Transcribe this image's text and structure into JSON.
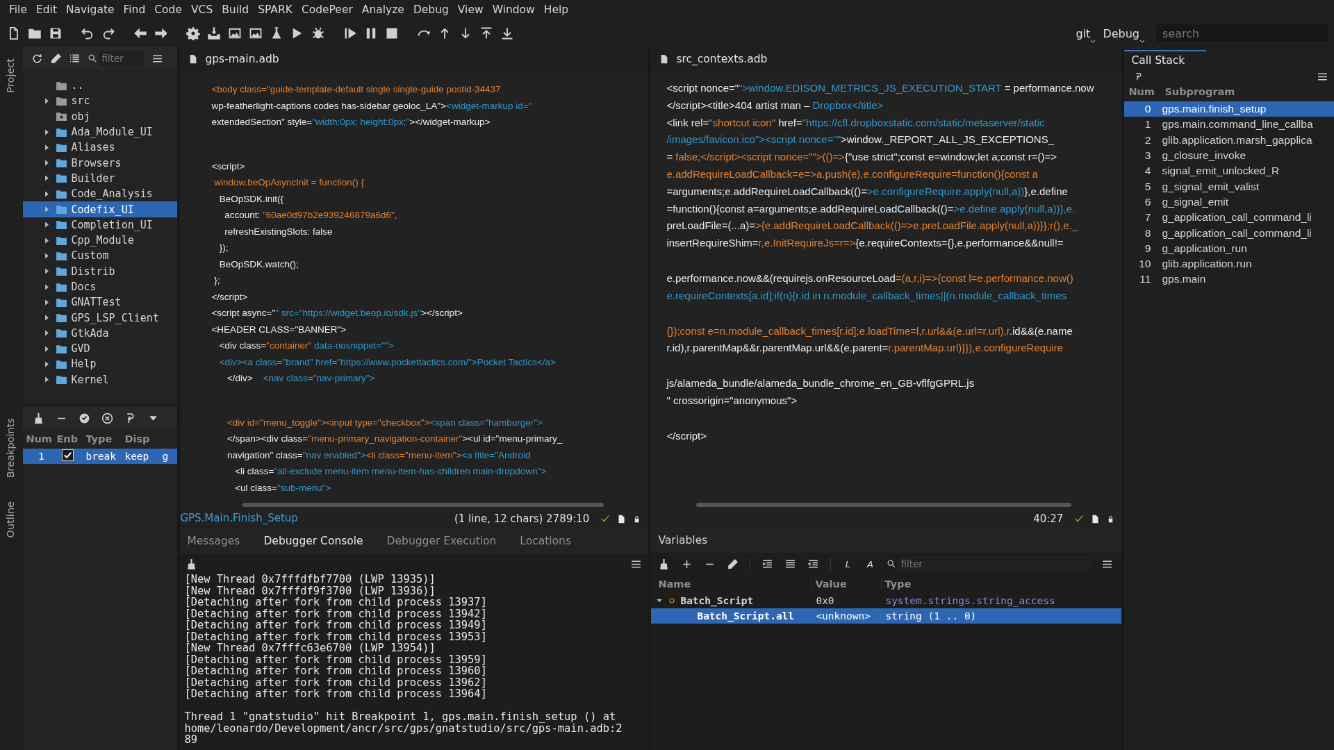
{
  "menu": [
    "File",
    "Edit",
    "Navigate",
    "Find",
    "Code",
    "VCS",
    "Build",
    "SPARK",
    "CodePeer",
    "Analyze",
    "Debug",
    "View",
    "Window",
    "Help"
  ],
  "toolbar_right": {
    "vcs": "git",
    "build_mode": "Debug",
    "search": {
      "placeholder": "search"
    }
  },
  "side_tabs": {
    "top": "Project",
    "bottom": [
      "Breakpoints",
      "Outline"
    ]
  },
  "project": {
    "filter": {
      "placeholder": "filter"
    },
    "items": [
      {
        "label": "..",
        "kind": "parent",
        "selected": false
      },
      {
        "label": "src",
        "kind": "source",
        "selected": false
      },
      {
        "label": "obj",
        "kind": "object",
        "selected": false
      },
      {
        "label": "Ada_Module_UI",
        "kind": "folder",
        "selected": false
      },
      {
        "label": "Aliases",
        "kind": "folder",
        "selected": false
      },
      {
        "label": "Browsers",
        "kind": "folder",
        "selected": false
      },
      {
        "label": "Builder",
        "kind": "folder",
        "selected": false
      },
      {
        "label": "Code_Analysis",
        "kind": "folder",
        "selected": false
      },
      {
        "label": "Codefix_UI",
        "kind": "folder",
        "selected": true
      },
      {
        "label": "Completion_UI",
        "kind": "folder",
        "selected": false
      },
      {
        "label": "Cpp_Module",
        "kind": "folder",
        "selected": false
      },
      {
        "label": "Custom",
        "kind": "folder",
        "selected": false
      },
      {
        "label": "Distrib",
        "kind": "folder",
        "selected": false
      },
      {
        "label": "Docs",
        "kind": "folder",
        "selected": false
      },
      {
        "label": "GNATTest",
        "kind": "folder",
        "selected": false
      },
      {
        "label": "GPS_LSP_Client",
        "kind": "folder",
        "selected": false
      },
      {
        "label": "GtkAda",
        "kind": "folder",
        "selected": false
      },
      {
        "label": "GVD",
        "kind": "folder",
        "selected": false
      },
      {
        "label": "Help",
        "kind": "folder",
        "selected": false
      },
      {
        "label": "Kernel",
        "kind": "folder",
        "selected": false
      }
    ]
  },
  "breakpoints": {
    "columns": [
      "Num",
      "Enb",
      "Type",
      "Disp"
    ],
    "rows": [
      {
        "num": "1",
        "enabled": true,
        "type": "break",
        "disp": "keep",
        "column_5": "g",
        "selected": true
      }
    ]
  },
  "editor_left": {
    "file": "gps-main.adb",
    "blocks": [
      [
        [
          {
            "kind": "keyword",
            "text": "<body class=\"guide-template-default single single-guide postid-34437"
          }
        ],
        [
          {
            "kind": "plain",
            "text": "wp-featherlight-captions codes has-sidebar geoloc_LA\">"
          },
          {
            "kind": "string",
            "text": "<widget-markup id=\""
          }
        ],
        [
          {
            "kind": "plain",
            "text": "extendedSection\" style="
          },
          {
            "kind": "string",
            "text": "\"width:0px; height:0px;\""
          },
          {
            "kind": "plain",
            "text": "></widget-markup>"
          }
        ]
      ],
      [
        [
          {
            "kind": "plain",
            "text": "<script>"
          }
        ],
        [
          {
            "kind": "keyword",
            "text": " window.beOpAsyncInit = function() {"
          }
        ],
        [
          {
            "kind": "plain",
            "text": "   BeOpSDK.init({"
          }
        ],
        [
          {
            "kind": "plain",
            "text": "     account: "
          },
          {
            "kind": "keyword",
            "text": "\"60ae0d97b2e939246879a6d6\","
          }
        ],
        [
          {
            "kind": "plain",
            "text": "     refreshExistingSlots: false"
          }
        ],
        [
          {
            "kind": "plain",
            "text": "   });"
          }
        ],
        [
          {
            "kind": "plain",
            "text": "   BeOpSDK.watch();"
          }
        ],
        [
          {
            "kind": "plain",
            "text": " };"
          }
        ],
        [
          {
            "kind": "plain",
            "text": "</script>"
          }
        ],
        [
          {
            "kind": "plain",
            "text": "<script async=\""
          },
          {
            "kind": "string",
            "text": "\" src=\"https://widget.beop.io/sdk.js\""
          },
          {
            "kind": "plain",
            "text": "></script>"
          }
        ],
        [
          {
            "kind": "plain",
            "text": "<HEADER CLASS=\"BANNER\">"
          }
        ],
        [
          {
            "kind": "plain",
            "text": "   <div class="
          },
          {
            "kind": "keyword",
            "text": "\"container\""
          },
          {
            "kind": "string",
            "text": " data-nosnippet=\"\">"
          }
        ],
        [
          {
            "kind": "string",
            "text": "   <div><a class=\"brand\" href=\"https://www.pockettactics.com/\">Pocket Tactics</a>"
          }
        ],
        [
          {
            "kind": "plain",
            "text": "      </div>    "
          },
          {
            "kind": "string",
            "text": "<nav class=\"nav-primary\">"
          }
        ]
      ],
      [
        [
          {
            "kind": "keyword",
            "text": "      <div id=\"menu_toggle\"><input type=\"checkbox\">"
          },
          {
            "kind": "string",
            "text": "<span class=\"hamburger\">"
          }
        ],
        [
          {
            "kind": "plain",
            "text": "      </span><div class="
          },
          {
            "kind": "keyword",
            "text": "\"menu-primary_navigation-container\""
          },
          {
            "kind": "plain",
            "text": "><ul id=\"menu-primary_"
          }
        ],
        [
          {
            "kind": "plain",
            "text": "      navigation\" class="
          },
          {
            "kind": "string",
            "text": "\"nav enabled\">"
          },
          {
            "kind": "keyword",
            "text": "<li class=\"menu-item\">"
          },
          {
            "kind": "string",
            "text": "<a title=\"Android"
          }
        ],
        [
          {
            "kind": "plain",
            "text": "         <li class="
          },
          {
            "kind": "string",
            "text": "\"all-exclude menu-item menu-item-has-children main-dropdown\">"
          }
        ],
        [
          {
            "kind": "plain",
            "text": "         <ul class="
          },
          {
            "kind": "string",
            "text": "\"sub-menu\">"
          }
        ]
      ]
    ],
    "status": {
      "scope": "GPS.Main.Finish_Setup",
      "position": "(1 line, 12 chars) 2789:10"
    }
  },
  "editor_right": {
    "file": "src_contexts.adb",
    "blocks": [
      [
        [
          {
            "kind": "plain",
            "text": "<script nonce=\""
          },
          {
            "kind": "string",
            "text": "\">window.EDISON_METRICS_JS_EXECUTION_START"
          },
          {
            "kind": "plain",
            "text": " = performance.now"
          }
        ],
        [
          {
            "kind": "plain",
            "text": "</script><title>404 artist man – "
          },
          {
            "kind": "string",
            "text": "Dropbox</title>"
          }
        ],
        [
          {
            "kind": "plain",
            "text": "<link rel="
          },
          {
            "kind": "keyword",
            "text": "\"shortcut icon\""
          },
          {
            "kind": "plain",
            "text": " href="
          },
          {
            "kind": "string",
            "text": "\"https://cfl.dropboxstatic.com/static/metaserver/static"
          }
        ],
        [
          {
            "kind": "string",
            "text": "/images/favicon.ico\"><script nonce=\"\""
          },
          {
            "kind": "plain",
            "text": ">window._REPORT_ALL_JS_EXCEPTIONS_"
          }
        ],
        [
          {
            "kind": "plain",
            "text": "= "
          },
          {
            "kind": "keyword",
            "text": "false;</script><script nonce=\"\">(()=>"
          },
          {
            "kind": "plain",
            "text": "{\"use strict\";const e=window;let a;const r=()=>"
          }
        ],
        [
          {
            "kind": "keyword",
            "text": "e.addRequireLoadCallback=e=>a.push(e),e.configureRequire=function(){const a"
          }
        ],
        [
          {
            "kind": "plain",
            "text": "=arguments;e.addRequireLoadCallback(()="
          },
          {
            "kind": "string",
            "text": ">e.configureRequire.apply(null,a))"
          },
          {
            "kind": "plain",
            "text": "},e.define"
          }
        ],
        [
          {
            "kind": "plain",
            "text": "=function(){const a=arguments;e.addRequireLoadCallback(()="
          },
          {
            "kind": "string",
            "text": ">e.define.apply(null,a))},e."
          }
        ],
        [
          {
            "kind": "plain",
            "text": "preLoadFile=(...a)="
          },
          {
            "kind": "keyword",
            "text": ">{e.addRequireLoadCallback(()=>e.preLoadFile.apply(null,a))}};r(),e._"
          }
        ],
        [
          {
            "kind": "plain",
            "text": "insertRequireShim="
          },
          {
            "kind": "keyword",
            "text": "r,e.InitRequireJs=r=>"
          },
          {
            "kind": "plain",
            "text": "{e.requireContexts={},e.performance&&null!="
          }
        ]
      ],
      [
        [
          {
            "kind": "plain",
            "text": "e.performance.now&&(requirejs.onResourceLoad"
          },
          {
            "kind": "keyword",
            "text": "=(a,r,i)=>{const l=e.performance.now()"
          }
        ],
        [
          {
            "kind": "string",
            "text": "e.requireContexts[a.id];if(n){r.id in n.module_callback_times||(n.module_callback_times"
          }
        ]
      ],
      [
        [
          {
            "kind": "keyword",
            "text": "{});const e=n.module_callback_times[r.id];e.loadTime=l,r.url&&(e.url=r.url),r"
          },
          {
            "kind": "plain",
            "text": ".id&&(e.name"
          }
        ],
        [
          {
            "kind": "plain",
            "text": "r.id),r.parentMap&&r.parentMap.url&&(e.parent="
          },
          {
            "kind": "keyword",
            "text": "r.parentMap.url)}}),e.configureRequire"
          }
        ]
      ],
      [
        [
          {
            "kind": "plain",
            "text": "js/alameda_bundle/alameda_bundle_chrome_en_GB-vflfgGPRL.js"
          }
        ],
        [
          {
            "kind": "plain",
            "text": "\" crossorigin=\"anonymous\">"
          }
        ]
      ],
      [
        [
          {
            "kind": "plain",
            "text": "</script>"
          }
        ]
      ]
    ],
    "status": {
      "position": "40:27"
    }
  },
  "console": {
    "tabs": [
      {
        "label": "Messages",
        "selected": false
      },
      {
        "label": "Debugger Console",
        "selected": true
      },
      {
        "label": "Debugger Execution",
        "selected": false
      },
      {
        "label": "Locations",
        "selected": false
      }
    ],
    "output": [
      "[New Thread 0x7fffdfbf7700 (LWP 13935)]",
      "[New Thread 0x7fffdf9f3700 (LWP 13936)]",
      "[Detaching after fork from child process 13937]",
      "[Detaching after fork from child process 13942]",
      "[Detaching after fork from child process 13949]",
      "[Detaching after fork from child process 13953]",
      "[New Thread 0x7fffc63e6700 (LWP 13954)]",
      "[Detaching after fork from child process 13959]",
      "[Detaching after fork from child process 13960]",
      "[Detaching after fork from child process 13962]",
      "[Detaching after fork from child process 13964]"
    ],
    "stop_message": [
      "Thread 1 \"gnatstudio\" hit Breakpoint 1, gps.main.finish_setup () at",
      "home/leonardo/Development/ancr/src/gps/gnatstudio/src/gps-main.adb:2",
      "89"
    ]
  },
  "variables": {
    "title": "Variables",
    "format_buttons": [
      "L",
      "A"
    ],
    "filter": {
      "placeholder": "filter"
    },
    "columns": [
      "Name",
      "Value",
      "Type"
    ],
    "rows": [
      {
        "name": "Batch_Script",
        "value": "0x0",
        "type": "system.strings.string_access",
        "expanded": true,
        "selected": false,
        "children": [
          {
            "name": "Batch_Script.all",
            "value": "<unknown>",
            "type": "string (1 .. 0)",
            "selected": true
          }
        ]
      }
    ]
  },
  "call_stack": {
    "tab": {
      "label": "Call Stack",
      "selected": true
    },
    "columns": [
      "Num",
      "Subprogram"
    ],
    "rows": [
      {
        "num": "0",
        "name": "gps.main.finish_setup",
        "selected": true
      },
      {
        "num": "1",
        "name": "gps.main.command_line_callba",
        "selected": false
      },
      {
        "num": "2",
        "name": "glib.application.marsh_gapplica",
        "selected": false
      },
      {
        "num": "3",
        "name": "g_closure_invoke",
        "selected": false
      },
      {
        "num": "4",
        "name": "signal_emit_unlocked_R",
        "selected": false
      },
      {
        "num": "5",
        "name": "g_signal_emit_valist",
        "selected": false
      },
      {
        "num": "6",
        "name": "g_signal_emit",
        "selected": false
      },
      {
        "num": "7",
        "name": "g_application_call_command_li",
        "selected": false
      },
      {
        "num": "8",
        "name": "g_application_call_command_li",
        "selected": false
      },
      {
        "num": "9",
        "name": "g_application_run",
        "selected": false
      },
      {
        "num": "10",
        "name": "glib.application.run",
        "selected": false
      },
      {
        "num": "11",
        "name": "gps.main",
        "selected": false
      }
    ]
  }
}
